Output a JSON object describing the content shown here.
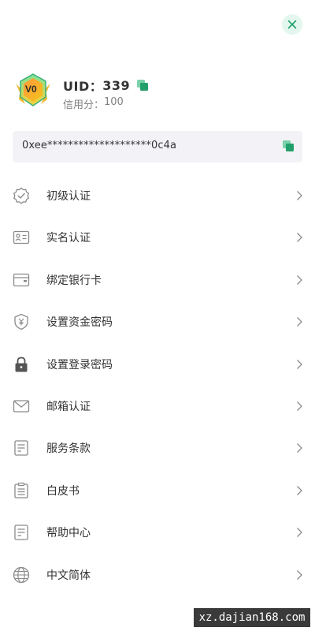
{
  "profile": {
    "level_badge": "V0",
    "uid_label": "UID：",
    "uid_value": "339",
    "credit_label": "信用分：",
    "credit_value": "100"
  },
  "address": {
    "value": "0xee********************0c4a"
  },
  "menu": [
    {
      "label": "初级认证",
      "icon": "verified-badge-icon"
    },
    {
      "label": "实名认证",
      "icon": "id-card-icon"
    },
    {
      "label": "绑定银行卡",
      "icon": "bank-card-icon"
    },
    {
      "label": "设置资金密码",
      "icon": "yuan-shield-icon"
    },
    {
      "label": "设置登录密码",
      "icon": "lock-icon"
    },
    {
      "label": "邮箱认证",
      "icon": "mail-icon"
    },
    {
      "label": "服务条款",
      "icon": "document-icon"
    },
    {
      "label": "白皮书",
      "icon": "clipboard-icon"
    },
    {
      "label": "帮助中心",
      "icon": "document-icon"
    },
    {
      "label": "中文简体",
      "icon": "globe-icon"
    }
  ],
  "watermark": "xz.dajian168.com",
  "colors": {
    "accent": "#22a06b",
    "close_bg": "#e3f7ef",
    "address_bg": "#f3f3f7",
    "icon_gray": "#8a8a8a"
  }
}
